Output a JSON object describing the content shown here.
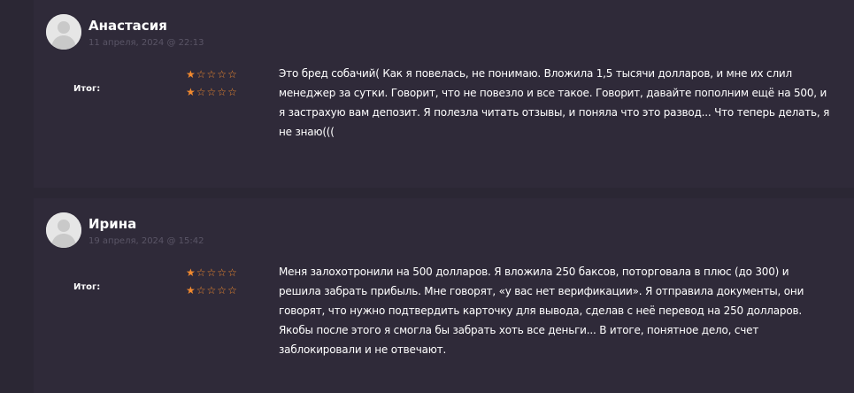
{
  "reviews": [
    {
      "author": "Анастасия",
      "date": "11 апреля, 2024 @ 22:13",
      "rating_label": "Итог:",
      "ratings": [
        1,
        1
      ],
      "max_rating": 5,
      "text": "Это бред собачий( Как я повелась, не понимаю. Вложила 1,5 тысячи долларов, и мне их слил менеджер за сутки. Говорит, что не повезло и все такое. Говорит, давайте пополним ещё на 500, и я застрахую вам депозит. Я полезла читать отзывы, и поняла что это развод... Что теперь делать, я не знаю((("
    },
    {
      "author": "Ирина",
      "date": "19 апреля, 2024 @ 15:42",
      "rating_label": "Итог:",
      "ratings": [
        1,
        1
      ],
      "max_rating": 5,
      "text": "Меня залохотронили на 500 долларов. Я вложила 250 баксов, поторговала в плюс (до 300) и решила забрать прибыль. Мне говорят, «у вас нет верификации». Я отправила документы, они говорят, что нужно подтвердить карточку для вывода, сделав с неё перевод на 250 долларов. Якобы после этого я смогла бы забрать хоть все деньги... В итоге, понятное дело, счет заблокировали и не отвечают."
    }
  ],
  "colors": {
    "background": "#2b2734",
    "card": "#2f2a39",
    "star": "#f28a2f",
    "date": "#5a5566"
  },
  "icons": {
    "avatar": "default-user-avatar-icon",
    "star_full": "star-filled-icon",
    "star_empty": "star-outline-icon"
  }
}
